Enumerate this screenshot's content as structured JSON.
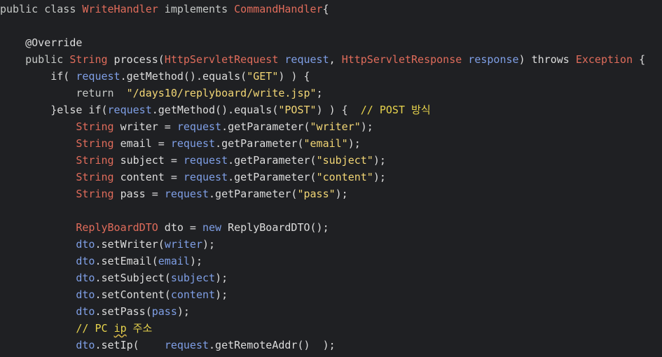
{
  "colors": {
    "background": "#1f2023",
    "keyword": "#c5c8c6",
    "type": "#e06c5b",
    "parameter": "#7f9fe6",
    "string": "#f2d675",
    "comment": "#e8d44d",
    "plain": "#dcdcdc"
  },
  "lines": [
    {
      "tokens": [
        {
          "t": "public class ",
          "c": "kw"
        },
        {
          "t": "WriteHandler",
          "c": "type"
        },
        {
          "t": " implements ",
          "c": "kw"
        },
        {
          "t": "CommandHandler",
          "c": "type"
        },
        {
          "t": "{",
          "c": "plain"
        }
      ]
    },
    {
      "tokens": []
    },
    {
      "tokens": [
        {
          "t": "    @Override",
          "c": "ann"
        }
      ]
    },
    {
      "tokens": [
        {
          "t": "    public ",
          "c": "kw"
        },
        {
          "t": "String",
          "c": "type"
        },
        {
          "t": " process(",
          "c": "plain"
        },
        {
          "t": "HttpServletRequest",
          "c": "type"
        },
        {
          "t": " request",
          "c": "param"
        },
        {
          "t": ", ",
          "c": "plain"
        },
        {
          "t": "HttpServletResponse",
          "c": "type"
        },
        {
          "t": " response",
          "c": "param"
        },
        {
          "t": ") throws ",
          "c": "plain"
        },
        {
          "t": "Exception",
          "c": "type"
        },
        {
          "t": " {",
          "c": "plain"
        }
      ]
    },
    {
      "tokens": [
        {
          "t": "        if( ",
          "c": "plain"
        },
        {
          "t": "request",
          "c": "param"
        },
        {
          "t": ".getMethod().equals(",
          "c": "plain"
        },
        {
          "t": "\"GET\"",
          "c": "str"
        },
        {
          "t": ") ) {",
          "c": "plain"
        }
      ]
    },
    {
      "tokens": [
        {
          "t": "            return  ",
          "c": "kw"
        },
        {
          "t": "\"/days10/replyboard/write.jsp\"",
          "c": "str"
        },
        {
          "t": ";",
          "c": "plain"
        }
      ]
    },
    {
      "tokens": [
        {
          "t": "        }else if(",
          "c": "plain"
        },
        {
          "t": "request",
          "c": "param"
        },
        {
          "t": ".getMethod().equals(",
          "c": "plain"
        },
        {
          "t": "\"POST\"",
          "c": "str"
        },
        {
          "t": ") ) {  ",
          "c": "plain"
        },
        {
          "t": "// POST 방식",
          "c": "cmt"
        }
      ]
    },
    {
      "tokens": [
        {
          "t": "            ",
          "c": "plain"
        },
        {
          "t": "String",
          "c": "type"
        },
        {
          "t": " writer = ",
          "c": "plain"
        },
        {
          "t": "request",
          "c": "param"
        },
        {
          "t": ".getParameter(",
          "c": "plain"
        },
        {
          "t": "\"writer\"",
          "c": "str"
        },
        {
          "t": ");",
          "c": "plain"
        }
      ]
    },
    {
      "tokens": [
        {
          "t": "            ",
          "c": "plain"
        },
        {
          "t": "String",
          "c": "type"
        },
        {
          "t": " email = ",
          "c": "plain"
        },
        {
          "t": "request",
          "c": "param"
        },
        {
          "t": ".getParameter(",
          "c": "plain"
        },
        {
          "t": "\"email\"",
          "c": "str"
        },
        {
          "t": ");",
          "c": "plain"
        }
      ]
    },
    {
      "tokens": [
        {
          "t": "            ",
          "c": "plain"
        },
        {
          "t": "String",
          "c": "type"
        },
        {
          "t": " subject = ",
          "c": "plain"
        },
        {
          "t": "request",
          "c": "param"
        },
        {
          "t": ".getParameter(",
          "c": "plain"
        },
        {
          "t": "\"subject\"",
          "c": "str"
        },
        {
          "t": ");",
          "c": "plain"
        }
      ]
    },
    {
      "tokens": [
        {
          "t": "            ",
          "c": "plain"
        },
        {
          "t": "String",
          "c": "type"
        },
        {
          "t": " content = ",
          "c": "plain"
        },
        {
          "t": "request",
          "c": "param"
        },
        {
          "t": ".getParameter(",
          "c": "plain"
        },
        {
          "t": "\"content\"",
          "c": "str"
        },
        {
          "t": ");",
          "c": "plain"
        }
      ]
    },
    {
      "tokens": [
        {
          "t": "            ",
          "c": "plain"
        },
        {
          "t": "String",
          "c": "type"
        },
        {
          "t": " pass = ",
          "c": "plain"
        },
        {
          "t": "request",
          "c": "param"
        },
        {
          "t": ".getParameter(",
          "c": "plain"
        },
        {
          "t": "\"pass\"",
          "c": "str"
        },
        {
          "t": ");",
          "c": "plain"
        }
      ]
    },
    {
      "tokens": []
    },
    {
      "tokens": [
        {
          "t": "            ",
          "c": "plain"
        },
        {
          "t": "ReplyBoardDTO",
          "c": "type"
        },
        {
          "t": " dto = ",
          "c": "plain"
        },
        {
          "t": "new",
          "c": "param"
        },
        {
          "t": " ReplyBoardDTO();",
          "c": "plain"
        }
      ]
    },
    {
      "tokens": [
        {
          "t": "            ",
          "c": "plain"
        },
        {
          "t": "dto",
          "c": "param"
        },
        {
          "t": ".setWriter(",
          "c": "plain"
        },
        {
          "t": "writer",
          "c": "param"
        },
        {
          "t": ");",
          "c": "plain"
        }
      ]
    },
    {
      "tokens": [
        {
          "t": "            ",
          "c": "plain"
        },
        {
          "t": "dto",
          "c": "param"
        },
        {
          "t": ".setEmail(",
          "c": "plain"
        },
        {
          "t": "email",
          "c": "param"
        },
        {
          "t": ");",
          "c": "plain"
        }
      ]
    },
    {
      "tokens": [
        {
          "t": "            ",
          "c": "plain"
        },
        {
          "t": "dto",
          "c": "param"
        },
        {
          "t": ".setSubject(",
          "c": "plain"
        },
        {
          "t": "subject",
          "c": "param"
        },
        {
          "t": ");",
          "c": "plain"
        }
      ]
    },
    {
      "tokens": [
        {
          "t": "            ",
          "c": "plain"
        },
        {
          "t": "dto",
          "c": "param"
        },
        {
          "t": ".setContent(",
          "c": "plain"
        },
        {
          "t": "content",
          "c": "param"
        },
        {
          "t": ");",
          "c": "plain"
        }
      ]
    },
    {
      "tokens": [
        {
          "t": "            ",
          "c": "plain"
        },
        {
          "t": "dto",
          "c": "param"
        },
        {
          "t": ".setPass(",
          "c": "plain"
        },
        {
          "t": "pass",
          "c": "param"
        },
        {
          "t": ");",
          "c": "plain"
        }
      ]
    },
    {
      "tokens": [
        {
          "t": "            ",
          "c": "plain"
        },
        {
          "t": "// PC ",
          "c": "cmt"
        },
        {
          "t": "ip",
          "c": "cmt",
          "warn": true
        },
        {
          "t": " 주소",
          "c": "cmt"
        }
      ]
    },
    {
      "tokens": [
        {
          "t": "            ",
          "c": "plain"
        },
        {
          "t": "dto",
          "c": "param"
        },
        {
          "t": ".setIp(    ",
          "c": "plain"
        },
        {
          "t": "request",
          "c": "param"
        },
        {
          "t": ".getRemoteAddr()  );",
          "c": "plain"
        }
      ]
    }
  ]
}
